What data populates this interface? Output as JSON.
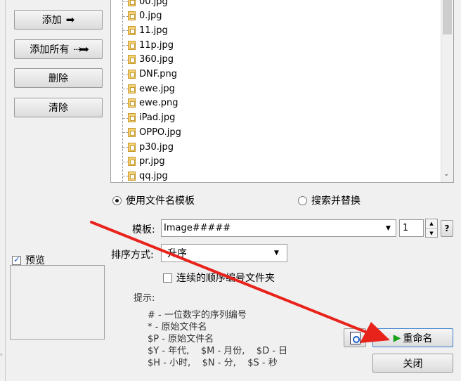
{
  "left_buttons": {
    "add": "添加",
    "add_all": "添加所有",
    "delete": "删除",
    "clear": "清除"
  },
  "files": [
    "00.jpg",
    "0.jpg",
    "11.jpg",
    "11p.jpg",
    "360.jpg",
    "DNF.png",
    "ewe.jpg",
    "ewe.png",
    "iPad.jpg",
    "OPPO.jpg",
    "p30.jpg",
    "pr.jpg",
    "qq.jpg"
  ],
  "mode": {
    "template_radio": "使用文件名模板",
    "search_replace_radio": "搜索并替换",
    "selected": "template"
  },
  "template": {
    "label": "模板:",
    "value": "Image#####",
    "start_number": "1",
    "help": "?"
  },
  "sort": {
    "label": "排序方式:",
    "value": "升序"
  },
  "continuous_folder": {
    "label": "连续的顺序编号文件夹",
    "checked": false
  },
  "preview": {
    "label": "预览",
    "checked": true
  },
  "hints": {
    "title": "提示:",
    "lines": [
      "# - 一位数字的序列编号",
      "*  - 原始文件名",
      "$P - 原始文件名",
      "$Y - 年代,    $M - 月份,    $D - 日",
      "$H - 小时,    $N - 分,    $S - 秒"
    ]
  },
  "actions": {
    "rename": "重命名",
    "close": "关闭"
  },
  "colors": {
    "arrow_annotation": "#e8231b",
    "play_icon": "#1aa21a"
  }
}
